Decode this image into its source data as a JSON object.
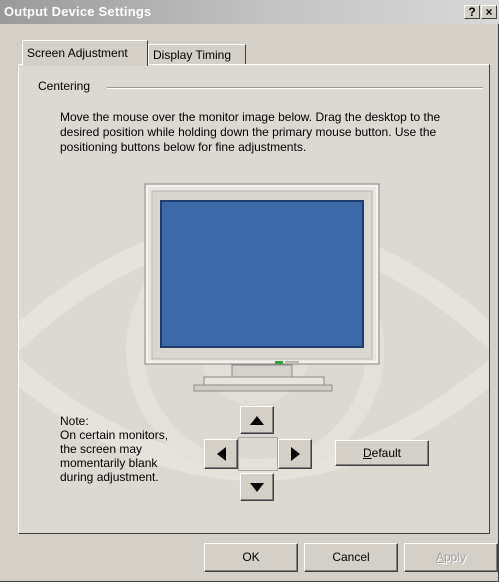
{
  "window": {
    "title": "Output Device Settings",
    "help_label": "?",
    "close_label": "×"
  },
  "tabs": [
    {
      "label": "Screen Adjustment",
      "active": true
    },
    {
      "label": "Display Timing",
      "active": false
    }
  ],
  "group": {
    "label": "Centering",
    "instructions": "Move the mouse over the monitor image below. Drag the desktop to the desired position while holding down the primary mouse button. Use the positioning buttons below for fine adjustments."
  },
  "note": {
    "lines": [
      "Note:",
      "On certain monitors,",
      "the screen may",
      "momentarily blank",
      "during adjustment."
    ]
  },
  "arrows": {
    "up_icon": "arrow-up-icon",
    "down_icon": "arrow-down-icon",
    "left_icon": "arrow-left-icon",
    "right_icon": "arrow-right-icon"
  },
  "buttons": {
    "default_label_underlined": "D",
    "default_label_rest": "efault",
    "ok_label": "OK",
    "cancel_label": "Cancel",
    "apply_label_underlined": "A",
    "apply_label_rest": "pply"
  },
  "colors": {
    "screen": "#3c6aa8",
    "dialog_face": "#d4d0c8"
  }
}
